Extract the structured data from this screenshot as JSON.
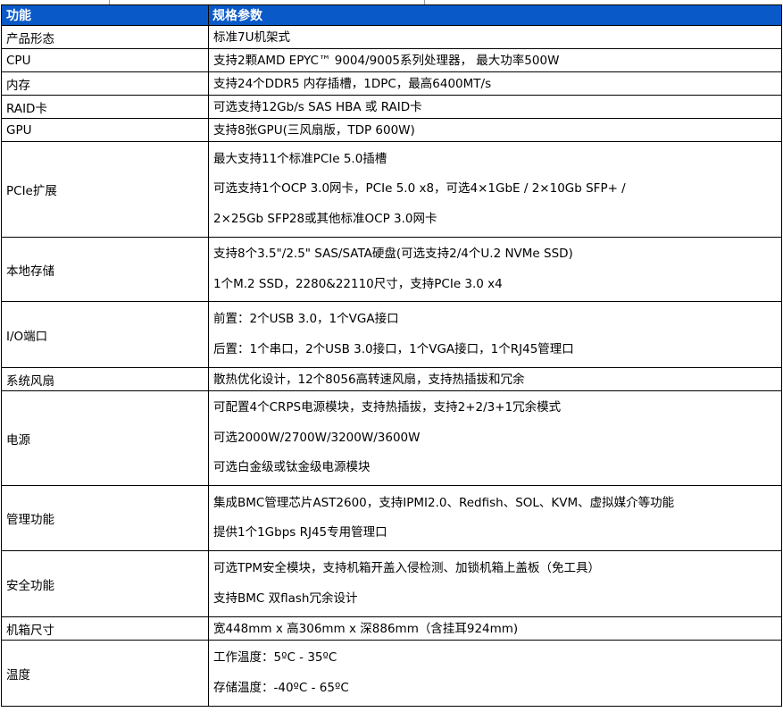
{
  "header": {
    "col1": "功能",
    "col2": "规格参数"
  },
  "rows": [
    {
      "label": "产品形态",
      "lines": [
        "标准7U机架式"
      ]
    },
    {
      "label": "CPU",
      "lines": [
        "支持2颗AMD EPYC™ 9004/9005系列处理器， 最大功率500W"
      ]
    },
    {
      "label": "内存",
      "lines": [
        "支持24个DDR5 内存插槽，1DPC，最高6400MT/s"
      ]
    },
    {
      "label": "RAID卡",
      "lines": [
        "可选支持12Gb/s SAS HBA 或 RAID卡"
      ]
    },
    {
      "label": "GPU",
      "lines": [
        "支持8张GPU(三风扇版，TDP 600W)"
      ]
    },
    {
      "label": "PCIe扩展",
      "lines": [
        "最大支持11个标准PCIe 5.0插槽",
        "可选支持1个OCP 3.0网卡，PCIe 5.0 x8，可选4×1GbE / 2×10Gb SFP+ /",
        "2×25Gb SFP28或其他标准OCP 3.0网卡"
      ]
    },
    {
      "label": "本地存储",
      "lines": [
        "支持8个3.5\"/2.5\" SAS/SATA硬盘(可选支持2/4个U.2 NVMe SSD)",
        "1个M.2 SSD，2280&22110尺寸，支持PCIe 3.0 x4"
      ]
    },
    {
      "label": "I/O端口",
      "lines": [
        "前置：2个USB 3.0，1个VGA接口",
        "后置：1个串口，2个USB 3.0接口，1个VGA接口，1个RJ45管理口"
      ]
    },
    {
      "label": "系统风扇",
      "lines": [
        "散热优化设计，12个8056高转速风扇，支持热插拔和冗余"
      ]
    },
    {
      "label": "电源",
      "lines": [
        "可配置4个CRPS电源模块，支持热插拔，支持2+2/3+1冗余模式",
        "可选2000W/2700W/3200W/3600W",
        "可选白金级或钛金级电源模块"
      ]
    },
    {
      "label": "管理功能",
      "lines": [
        "集成BMC管理芯片AST2600，支持IPMI2.0、Redfish、SOL、KVM、虚拟媒介等功能",
        "提供1个1Gbps RJ45专用管理口"
      ]
    },
    {
      "label": "安全功能",
      "lines": [
        "可选TPM安全模块，支持机箱开盖入侵检测、加锁机箱上盖板（免工具）",
        "支持BMC 双flash冗余设计"
      ]
    },
    {
      "label": "机箱尺寸",
      "lines": [
        "宽448mm x 高306mm x 深886mm（含挂耳924mm)"
      ]
    },
    {
      "label": "温度",
      "lines": [
        "工作温度：5ºC - 35ºC",
        "存储温度：-40ºC - 65ºC"
      ]
    }
  ]
}
